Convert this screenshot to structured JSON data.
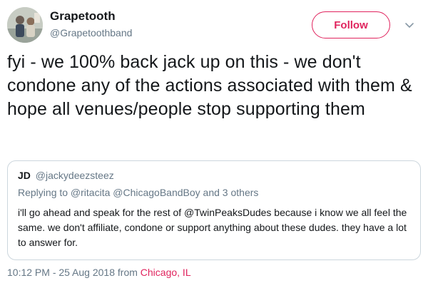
{
  "author": {
    "name": "Grapetooth",
    "handle": "@Grapetoothband",
    "avatar": "avatar-photo"
  },
  "follow_label": "Follow",
  "caret_icon": "chevron-down-icon",
  "tweet_text": "fyi - we 100% back jack up on this - we don't condone any of the actions associated with them & hope all venues/people stop supporting them",
  "quote": {
    "name": "JD",
    "handle": "@jackydeezsteez",
    "replying_to": "Replying to @ritacita @ChicagoBandBoy and 3 others",
    "text": "i'll go ahead and speak for the rest of @TwinPeaksDudes because i know we all feel the same. we don't affiliate, condone or support anything about these dudes. they have a lot to answer for."
  },
  "timestamp": "10:12 PM - 25 Aug 2018",
  "from_label": "from",
  "location": "Chicago, IL",
  "colors": {
    "accent": "#e0245e",
    "secondary_text": "#657786",
    "border": "#ccd6dd"
  }
}
